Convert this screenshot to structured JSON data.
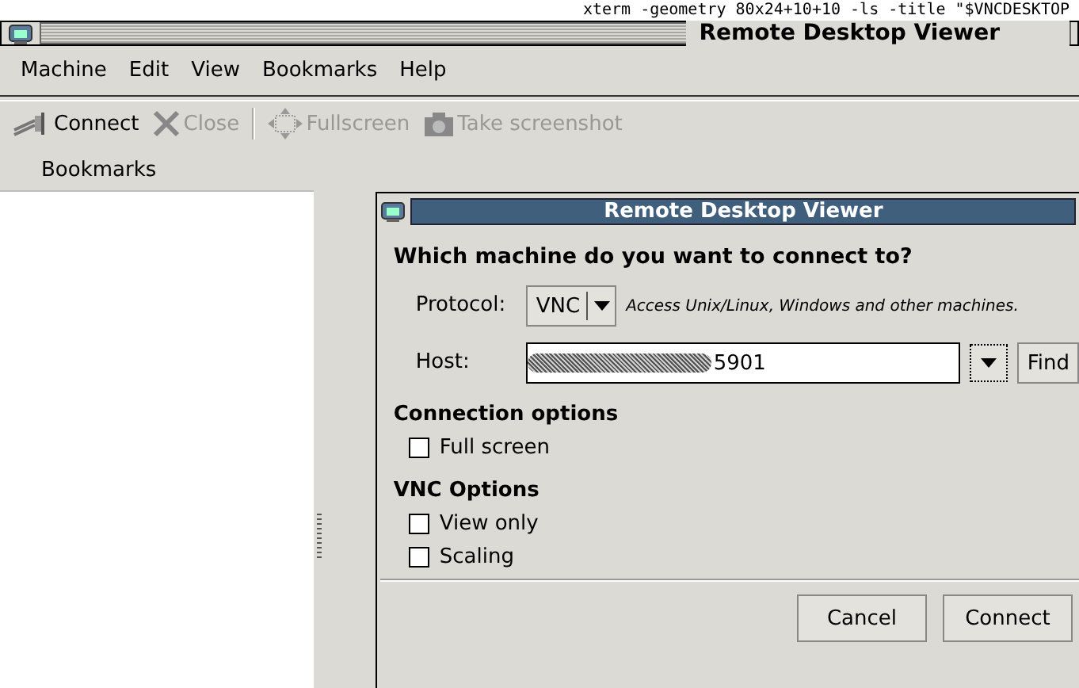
{
  "background_terminal": {
    "text": "xterm -geometry 80x24+10+10 -ls -title \"$VNCDESKTOP"
  },
  "window": {
    "title": "Remote Desktop Viewer"
  },
  "menu_bar": [
    "Machine",
    "Edit",
    "View",
    "Bookmarks",
    "Help"
  ],
  "toolbar": [
    {
      "kind": "connect",
      "label": "Connect",
      "disabled": false
    },
    {
      "kind": "close",
      "label": "Close",
      "disabled": true
    },
    {
      "kind": "fullscreen",
      "label": "Fullscreen",
      "disabled": true
    },
    {
      "kind": "screenshot",
      "label": "Take screenshot",
      "disabled": true
    }
  ],
  "sidebar": {
    "header": "Bookmarks"
  },
  "dialog": {
    "title": "Remote Desktop Viewer",
    "heading": "Which machine do you want to connect to?",
    "protocol": {
      "label": "Protocol:",
      "value": "VNC",
      "description": "Access Unix/Linux, Windows and other machines."
    },
    "host": {
      "label": "Host:",
      "value": "5901",
      "find": "Find"
    },
    "sections": [
      {
        "title": "Connection options",
        "options": [
          {
            "label": "Full screen",
            "checked": false
          }
        ]
      },
      {
        "title": "VNC Options",
        "options": [
          {
            "label": "View only",
            "checked": false
          },
          {
            "label": "Scaling",
            "checked": false
          }
        ]
      }
    ],
    "buttons": [
      "Cancel",
      "Connect"
    ]
  }
}
